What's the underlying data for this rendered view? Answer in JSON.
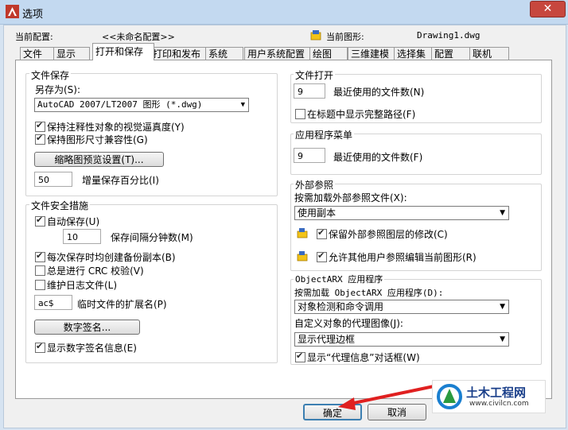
{
  "window": {
    "title": "选项",
    "close": "✕"
  },
  "profile": {
    "current_config_label": "当前配置:",
    "current_config_value": "<<未命名配置>>",
    "current_drawing_label": "当前图形:",
    "current_drawing_value": "Drawing1.dwg"
  },
  "tabs": [
    "文件",
    "显示",
    "打开和保存",
    "打印和发布",
    "系统",
    "用户系统配置",
    "绘图",
    "三维建模",
    "选择集",
    "配置",
    "联机"
  ],
  "active_tab": "打开和保存",
  "file_save": {
    "title": "文件保存",
    "save_as_label": "另存为(S):",
    "save_as_value": "AutoCAD 2007/LT2007 图形 (*.dwg)",
    "cb_annot": "保持注释性对象的视觉逼真度(Y)",
    "cb_size": "保持图形尺寸兼容性(G)",
    "thumbnail_btn": "缩略图预览设置(T)...",
    "incr_value": "50",
    "incr_label": "增量保存百分比(I)"
  },
  "file_safety": {
    "title": "文件安全措施",
    "autosave": "自动保存(U)",
    "interval_value": "10",
    "interval_label": "保存间隔分钟数(M)",
    "backup": "每次保存时均创建备份副本(B)",
    "crc": "总是进行 CRC 校验(V)",
    "log": "维护日志文件(L)",
    "ext_value": "ac$",
    "ext_label": "临时文件的扩展名(P)",
    "digsig_btn": "数字签名...",
    "show_digsig": "显示数字签名信息(E)"
  },
  "file_open": {
    "title": "文件打开",
    "recent_value": "9",
    "recent_label": "最近使用的文件数(N)",
    "fullpath": "在标题中显示完整路径(F)"
  },
  "app_menu": {
    "title": "应用程序菜单",
    "recent_value": "9",
    "recent_label": "最近使用的文件数(F)"
  },
  "xref": {
    "title": "外部参照",
    "demand_label": "按需加载外部参照文件(X):",
    "demand_value": "使用副本",
    "retain": "保留外部参照图层的修改(C)",
    "allow": "允许其他用户参照编辑当前图形(R)"
  },
  "objectarx": {
    "title": "ObjectARX 应用程序",
    "demand_label": "按需加载 ObjectARX 应用程序(D):",
    "demand_value": "对象检测和命令调用",
    "proxy_label": "自定义对象的代理图像(J):",
    "proxy_value": "显示代理边框",
    "proxy_dialog": "显示“代理信息”对话框(W)"
  },
  "buttons": {
    "ok": "确定",
    "cancel": "取消"
  },
  "watermark": {
    "name": "土木工程网",
    "url": "www.civilcn.com"
  },
  "checkbox_states": {
    "annot": true,
    "size": true,
    "autosave": true,
    "backup": true,
    "crc": false,
    "log": false,
    "show_digsig": true,
    "fullpath": false,
    "retain": true,
    "allow": true,
    "proxy_dialog": true
  },
  "colors": {
    "accent_red": "#e02020",
    "title_bg": "#c3d9f0",
    "close_bg": "#c7473e"
  }
}
